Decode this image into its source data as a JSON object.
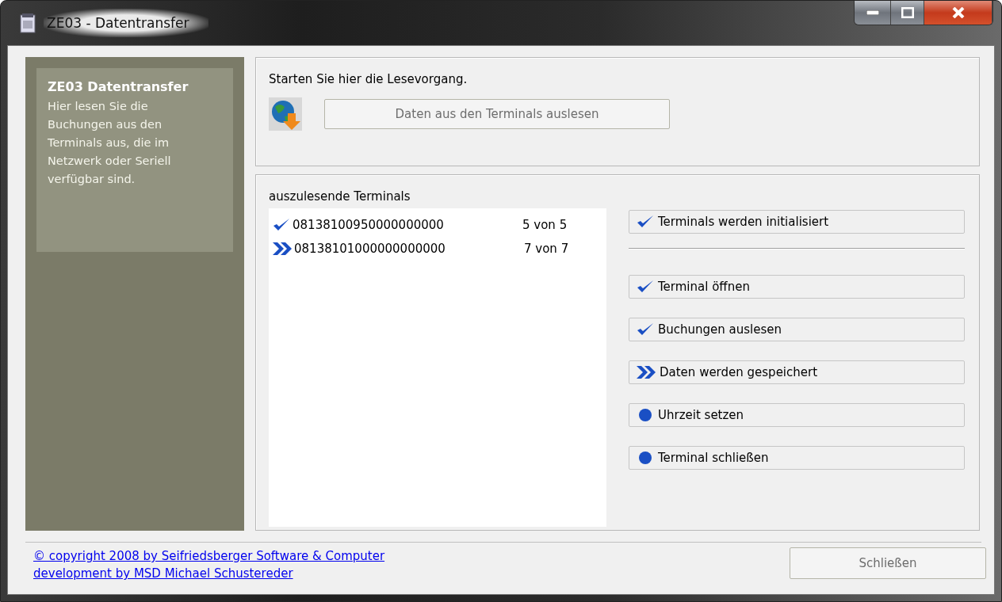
{
  "window": {
    "title": "ZE03 - Datentransfer"
  },
  "sidebar": {
    "title": "ZE03 Datentransfer",
    "text": "Hier lesen Sie die Buchungen aus den Terminals aus, die im Netzwerk oder Seriell verfügbar sind."
  },
  "start": {
    "prompt": "Starten Sie hier die Lesevorgang.",
    "button": {
      "label": "Daten aus den Terminals auslesen",
      "disabled": true
    }
  },
  "terminals": {
    "label": "auszulesende Terminals",
    "items": [
      {
        "id": "08138100950000000000",
        "progress": "5 von 5",
        "kind": "done"
      },
      {
        "id": "08138101000000000000",
        "progress": "7 von 7",
        "kind": "active"
      }
    ]
  },
  "steps": [
    {
      "label": "Terminals werden initialisiert",
      "kind": "done"
    },
    {
      "label": "Terminal öffnen",
      "kind": "done"
    },
    {
      "label": "Buchungen auslesen",
      "kind": "done"
    },
    {
      "label": "Daten werden gespeichert",
      "kind": "active"
    },
    {
      "label": "Uhrzeit setzen",
      "kind": "pending"
    },
    {
      "label": "Terminal schließen",
      "kind": "pending"
    }
  ],
  "footer": {
    "links": [
      "© copyright 2008 by Seifriedsberger Software & Computer",
      "development by MSD Michael Schustereder"
    ],
    "close_button": {
      "label": "Schließen",
      "disabled": true
    }
  }
}
